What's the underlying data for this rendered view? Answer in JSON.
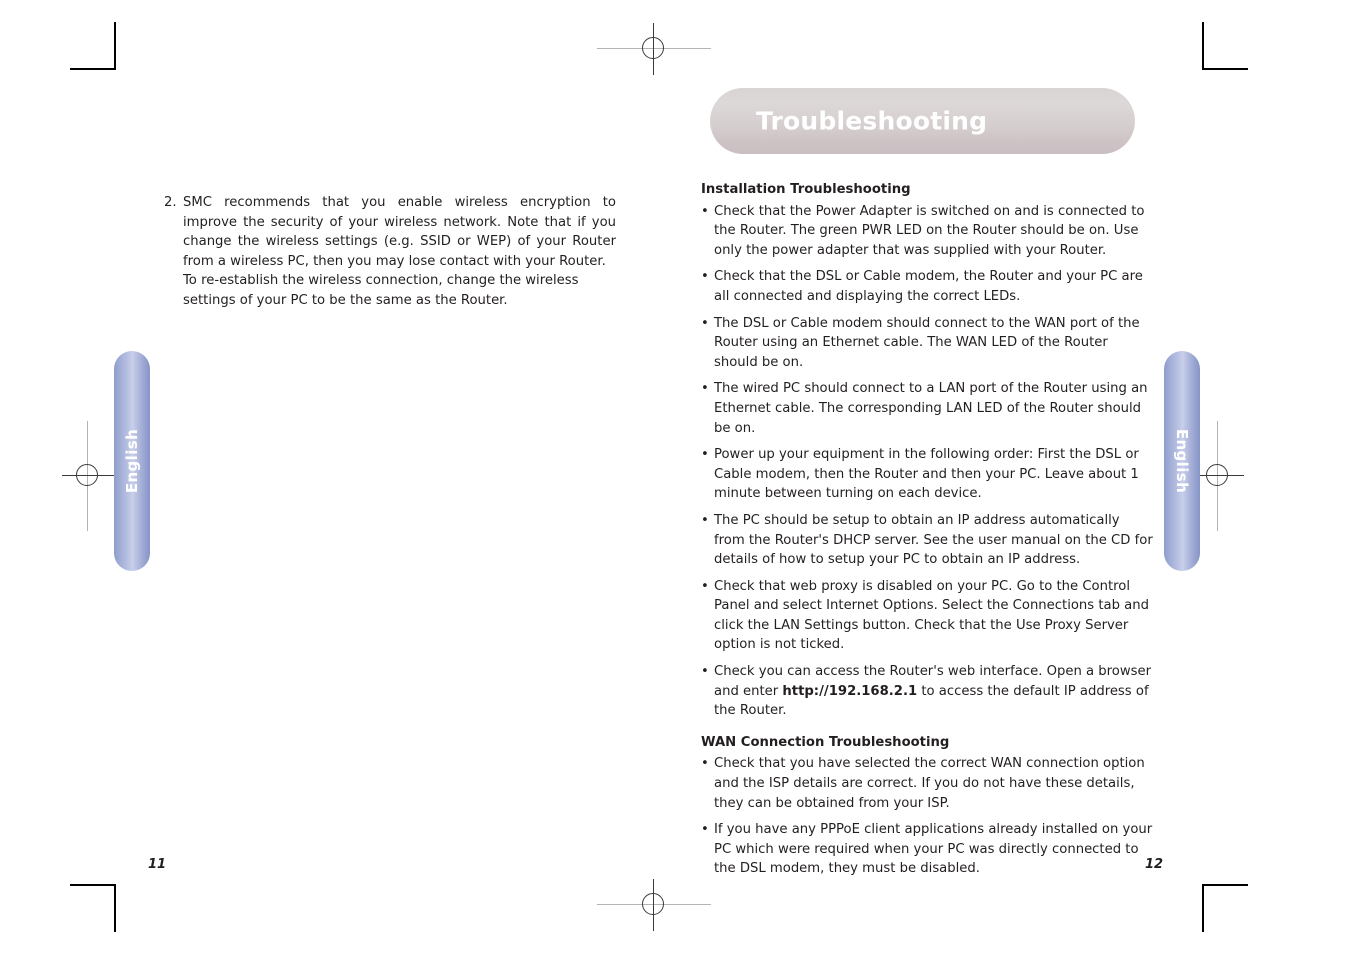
{
  "document": {
    "kind": "printed-manual-spread",
    "bullet_glyph": "•"
  },
  "side_tabs": {
    "left_label": "English",
    "right_label": "English",
    "color": "#9aa7d3"
  },
  "left_page": {
    "page_number": "11",
    "numbered_item": {
      "number": "2.",
      "text": "SMC recommends that you enable wireless encryption to improve the security of your wireless network. Note that if you change the wireless settings (e.g. SSID or WEP) of your Router from a wireless PC, then you may lose contact with your Router.",
      "text_second_paragraph": "To re-establish the wireless connection, change the wireless settings of your PC to be the same as the Router."
    }
  },
  "right_page": {
    "page_number": "12",
    "chapter_title": "Troubleshooting",
    "chapter_pill_color": "#d6cfd0",
    "sections": [
      {
        "heading": "Installation Troubleshooting",
        "bullets": [
          "Check that the Power Adapter is switched on and is connected to the Router. The green PWR LED on the Router should be on. Use only the power adapter that was supplied with your Router.",
          "Check that the DSL or Cable modem, the Router and your PC are all connected and displaying the correct LEDs.",
          "The DSL or Cable modem should connect to the WAN port of the Router using an Ethernet cable. The WAN LED of the Router should be on.",
          "The wired PC should connect to a LAN port of the Router using an Ethernet cable. The corresponding LAN LED of the Router should be on.",
          "Power up your equipment in the following order: First the DSL or Cable modem, then the Router and then your PC. Leave about 1 minute between turning on each device.",
          "The PC should be setup to obtain an IP address automatically from the Router's DHCP server. See the user manual on the CD for details of how to setup your PC to obtain an IP address.",
          "Check that web proxy is disabled on your PC. Go to the Control Panel and select Internet Options. Select the Connections tab and click the LAN Settings button. Check that the Use Proxy Server option is not ticked."
        ],
        "bullet_with_url": {
          "before": "Check you can access the Router's web interface. Open a browser and enter ",
          "url": "http://192.168.2.1",
          "after": " to access the default IP address of the Router."
        }
      },
      {
        "heading": "WAN Connection Troubleshooting",
        "bullets": [
          "Check that you have selected the correct WAN connection option and the ISP details are correct. If you do not have these details, they can be obtained from your ISP.",
          "If you have any PPPoE client applications already installed on your PC which were required when your PC was directly connected to the DSL modem, they must be disabled."
        ]
      }
    ]
  }
}
